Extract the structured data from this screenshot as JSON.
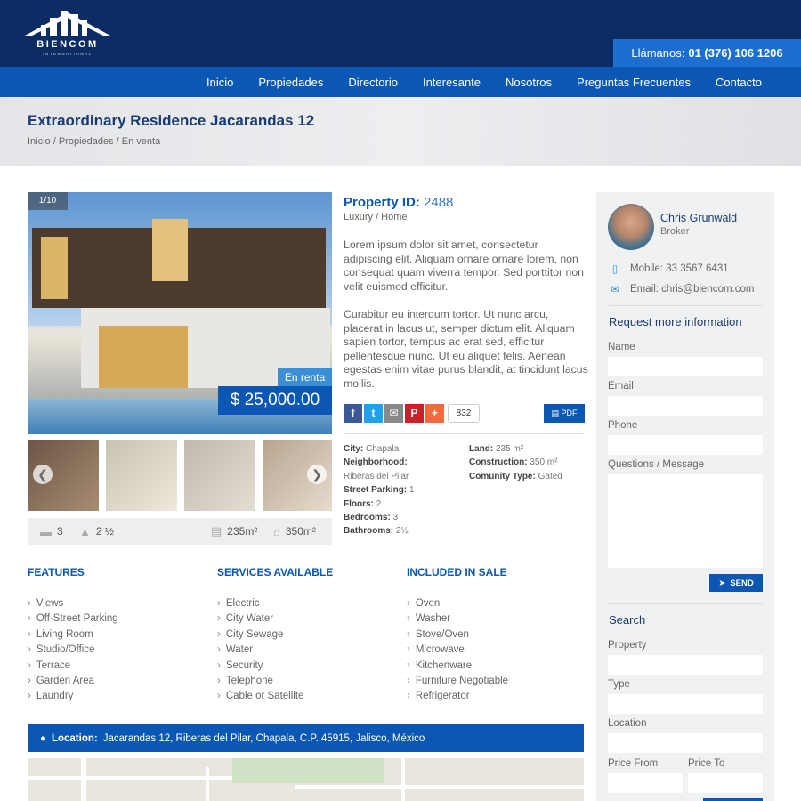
{
  "header": {
    "brand": "BIENCOM",
    "brand_sub": "INTERNATIONAL",
    "call_label": "Llámanos:",
    "call_number": "01 (376) 106 1206"
  },
  "nav": [
    "Inicio",
    "Propiedades",
    "Directorio",
    "Interesante",
    "Nosotros",
    "Preguntas Frecuentes",
    "Contacto"
  ],
  "page": {
    "title": "Extraordinary Residence Jacarandas 12",
    "breadcrumb": "Inicio / Propiedades / En venta"
  },
  "gallery": {
    "counter": "1/10",
    "status_badge": "En renta",
    "price": "$ 25,000.00",
    "prev_icon": "❮",
    "next_icon": "❯"
  },
  "specs": {
    "beds": "3",
    "baths": "2 ½",
    "land": "235m²",
    "construction": "350m²"
  },
  "property": {
    "id_label": "Property ID:",
    "id_value": "2488",
    "type": "Luxury / Home",
    "desc1": "Lorem ipsum dolor sit amet, consectetur adipiscing elit. Aliquam ornare ornare lorem, non consequat quam viverra tempor. Sed porttitor non velit euismod efficitur.",
    "desc2": "Curabitur eu interdum tortor. Ut nunc arcu, placerat in lacus ut, semper dictum elit. Aliquam sapien tortor, tempus ac erat sed, efficitur pellentesque nunc. Ut eu aliquet felis. Aenean egestas enim vitae purus blandit, at tincidunt lacus mollis.",
    "share_count": "832",
    "pdf_label": "PDF"
  },
  "details": {
    "city_label": "City:",
    "city": "Chapala",
    "neighborhood_label": "Neighborhood:",
    "neighborhood": "Riberas del Pilar",
    "street_parking_label": "Street Parking:",
    "street_parking": "1",
    "floors_label": "Floors:",
    "floors": "2",
    "bedrooms_label": "Bedrooms:",
    "bedrooms": "3",
    "bathrooms_label": "Bathrooms:",
    "bathrooms": "2½",
    "land_label": "Land:",
    "land": "235 m²",
    "construction_label": "Construction:",
    "construction": "350 m²",
    "community_label": "Comunity Type:",
    "community": "Gated"
  },
  "features": {
    "title": "FEATURES",
    "items": [
      "Views",
      "Off-Street Parking",
      "Living Room",
      "Studio/Office",
      "Terrace",
      "Garden Area",
      "Laundry"
    ]
  },
  "services": {
    "title": "SERVICES AVAILABLE",
    "items": [
      "Electric",
      "City Water",
      "City Sewage",
      "Water",
      "Security",
      "Telephone",
      "Cable or Satellite"
    ]
  },
  "included": {
    "title": "INCLUDED IN SALE",
    "items": [
      "Oven",
      "Washer",
      "Stove/Oven",
      "Microwave",
      "Kitchenware",
      "Furniture Negotiable",
      "Refrigerator"
    ]
  },
  "location": {
    "label": "Location:",
    "address": "Jacarandas 12, Riberas del Pilar, Chapala, C.P. 45915, Jalisco, México"
  },
  "agent": {
    "name": "Chris Grünwald",
    "role": "Broker",
    "mobile": "Mobile: 33 3567 6431",
    "email": "Email: chris@biencom.com"
  },
  "request": {
    "title": "Request more information",
    "name_label": "Name",
    "email_label": "Email",
    "phone_label": "Phone",
    "message_label": "Questions / Message",
    "send_label": "SEND"
  },
  "search": {
    "title": "Search",
    "property_label": "Property",
    "type_label": "Type",
    "location_label": "Location",
    "price_from_label": "Price From",
    "price_to_label": "Price To"
  },
  "colors": {
    "header_dark": "#0d2c63",
    "nav_blue": "#0b57b4",
    "accent_blue": "#1c6fd1",
    "sidebar_bg": "#f0f1f3"
  }
}
